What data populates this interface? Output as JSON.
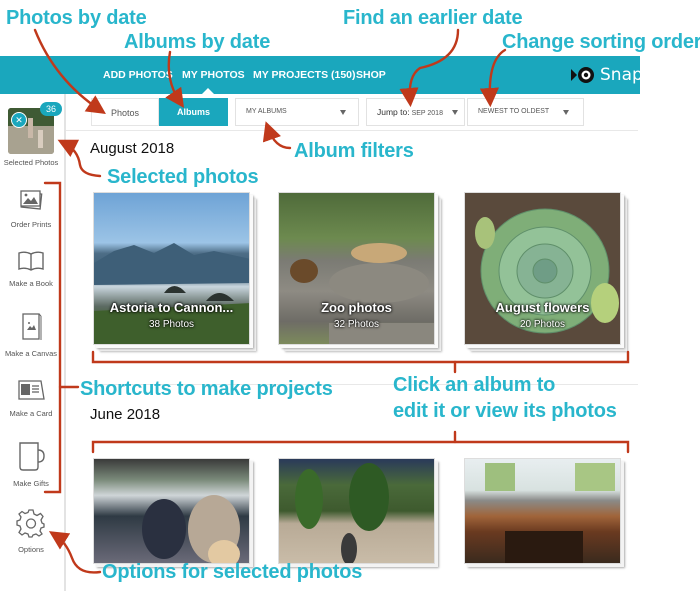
{
  "annotations": {
    "photos_by_date": "Photos by date",
    "albums_by_date": "Albums by date",
    "find_earlier_date": "Find an earlier date",
    "change_sorting": "Change sorting order",
    "album_filters": "Album filters",
    "selected_photos": "Selected photos",
    "shortcuts": "Shortcuts to make projects",
    "click_album_line1": "Click an album to",
    "click_album_line2": "edit it or view its photos",
    "options_selected": "Options for selected photos"
  },
  "colors": {
    "brand": "#1aa7bd",
    "annotation_text": "#29b6cc",
    "annotation_arrow": "#c0391b"
  },
  "nav": {
    "items": [
      "ADD PHOTOS",
      "MY PHOTOS",
      "MY PROJECTS (150)",
      "SHOP"
    ],
    "active": "MY PHOTOS",
    "logo_text": "Snapfish",
    "logo_icon": "fish-icon"
  },
  "sidebar": {
    "selected": {
      "count": "36",
      "label": "Selected Photos"
    },
    "items": [
      {
        "label": "Order Prints",
        "icon": "prints-icon"
      },
      {
        "label": "Make a Book",
        "icon": "book-icon"
      },
      {
        "label": "Make a Canvas",
        "icon": "canvas-icon"
      },
      {
        "label": "Make a Card",
        "icon": "card-icon"
      },
      {
        "label": "Make Gifts",
        "icon": "mug-icon"
      },
      {
        "label": "Options",
        "icon": "gear-icon"
      }
    ]
  },
  "toolbar": {
    "view_toggle": {
      "photos": "Photos",
      "albums": "Albums",
      "active": "Albums"
    },
    "album_filter": {
      "value": "MY ALBUMS"
    },
    "jump_to": {
      "label": "Jump to:",
      "value": "SEP 2018"
    },
    "sort": {
      "value": "NEWEST TO OLDEST"
    }
  },
  "sections": [
    {
      "title": "August 2018",
      "albums": [
        {
          "title": "Astoria to Cannon...",
          "count": "38 Photos"
        },
        {
          "title": "Zoo photos",
          "count": "32 Photos"
        },
        {
          "title": "August flowers",
          "count": "20 Photos"
        }
      ]
    },
    {
      "title": "June 2018",
      "albums": [
        {
          "title": "",
          "count": ""
        },
        {
          "title": "",
          "count": ""
        },
        {
          "title": "",
          "count": ""
        }
      ]
    }
  ]
}
